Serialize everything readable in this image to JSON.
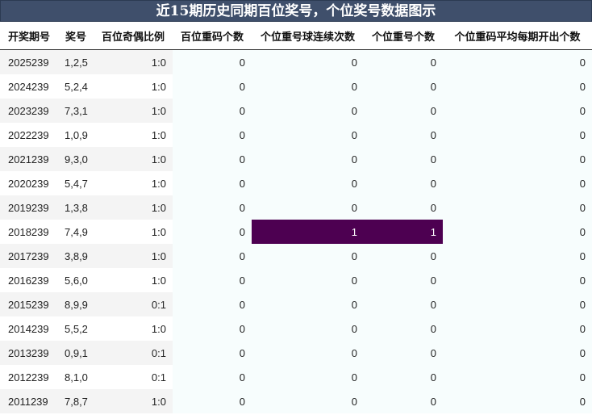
{
  "title": "近15期历史同期百位奖号，个位奖号数据图示",
  "headers": [
    "开奖期号",
    "奖号",
    "百位奇偶比例",
    "百位重码个数",
    "个位重号球连续次数",
    "个位重号个数",
    "个位重码平均每期开出个数"
  ],
  "rows": [
    {
      "issue": "2025239",
      "nums": "1,2,5",
      "ratio": "1:0",
      "hundred_repeat": "0",
      "unit_consec": "0",
      "unit_repeat": "0",
      "unit_avg": "0"
    },
    {
      "issue": "2024239",
      "nums": "5,2,4",
      "ratio": "1:0",
      "hundred_repeat": "0",
      "unit_consec": "0",
      "unit_repeat": "0",
      "unit_avg": "0"
    },
    {
      "issue": "2023239",
      "nums": "7,3,1",
      "ratio": "1:0",
      "hundred_repeat": "0",
      "unit_consec": "0",
      "unit_repeat": "0",
      "unit_avg": "0"
    },
    {
      "issue": "2022239",
      "nums": "1,0,9",
      "ratio": "1:0",
      "hundred_repeat": "0",
      "unit_consec": "0",
      "unit_repeat": "0",
      "unit_avg": "0"
    },
    {
      "issue": "2021239",
      "nums": "9,3,0",
      "ratio": "1:0",
      "hundred_repeat": "0",
      "unit_consec": "0",
      "unit_repeat": "0",
      "unit_avg": "0"
    },
    {
      "issue": "2020239",
      "nums": "5,4,7",
      "ratio": "1:0",
      "hundred_repeat": "0",
      "unit_consec": "0",
      "unit_repeat": "0",
      "unit_avg": "0"
    },
    {
      "issue": "2019239",
      "nums": "1,3,8",
      "ratio": "1:0",
      "hundred_repeat": "0",
      "unit_consec": "0",
      "unit_repeat": "0",
      "unit_avg": "0"
    },
    {
      "issue": "2018239",
      "nums": "7,4,9",
      "ratio": "1:0",
      "hundred_repeat": "0",
      "unit_consec": "1",
      "unit_repeat": "1",
      "unit_avg": "0",
      "highlight": true
    },
    {
      "issue": "2017239",
      "nums": "3,8,9",
      "ratio": "1:0",
      "hundred_repeat": "0",
      "unit_consec": "0",
      "unit_repeat": "0",
      "unit_avg": "0"
    },
    {
      "issue": "2016239",
      "nums": "5,6,0",
      "ratio": "1:0",
      "hundred_repeat": "0",
      "unit_consec": "0",
      "unit_repeat": "0",
      "unit_avg": "0"
    },
    {
      "issue": "2015239",
      "nums": "8,9,9",
      "ratio": "0:1",
      "hundred_repeat": "0",
      "unit_consec": "0",
      "unit_repeat": "0",
      "unit_avg": "0"
    },
    {
      "issue": "2014239",
      "nums": "5,5,2",
      "ratio": "1:0",
      "hundred_repeat": "0",
      "unit_consec": "0",
      "unit_repeat": "0",
      "unit_avg": "0"
    },
    {
      "issue": "2013239",
      "nums": "0,9,1",
      "ratio": "0:1",
      "hundred_repeat": "0",
      "unit_consec": "0",
      "unit_repeat": "0",
      "unit_avg": "0"
    },
    {
      "issue": "2012239",
      "nums": "8,1,0",
      "ratio": "0:1",
      "hundred_repeat": "0",
      "unit_consec": "0",
      "unit_repeat": "0",
      "unit_avg": "0"
    },
    {
      "issue": "2011239",
      "nums": "7,8,7",
      "ratio": "1:0",
      "hundred_repeat": "0",
      "unit_consec": "0",
      "unit_repeat": "0",
      "unit_avg": "0"
    }
  ],
  "colors": {
    "title_bg": "#3f4f6b",
    "highlight_bg": "#4d0051",
    "shade_bg": "#f7fdfd"
  }
}
